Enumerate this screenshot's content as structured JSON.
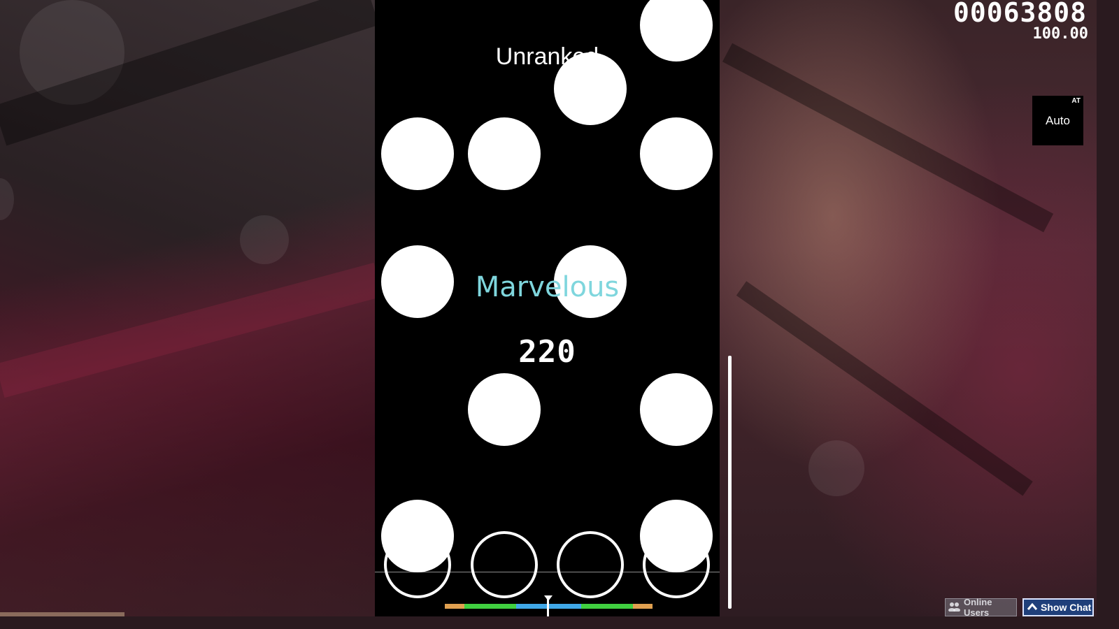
{
  "playfield": {
    "title": "Unranked",
    "judgement": "Marvelous",
    "combo": "220",
    "lanes": 4
  },
  "hud": {
    "score": "00063808",
    "accuracy": "100.00"
  },
  "mod": {
    "abbr": "AT",
    "name": "Auto"
  },
  "footer": {
    "online_users_label": "Online Users",
    "show_chat_label": "Show Chat"
  },
  "colors": {
    "judgement": "#7fd6dd",
    "hit_early_late": "#e0a050",
    "hit_good": "#40d040",
    "hit_perfect": "#40a8e8",
    "chat_button": "#1f3f7a"
  },
  "icons": {
    "online_users": "users-icon",
    "show_chat": "chevron-up-icon"
  }
}
